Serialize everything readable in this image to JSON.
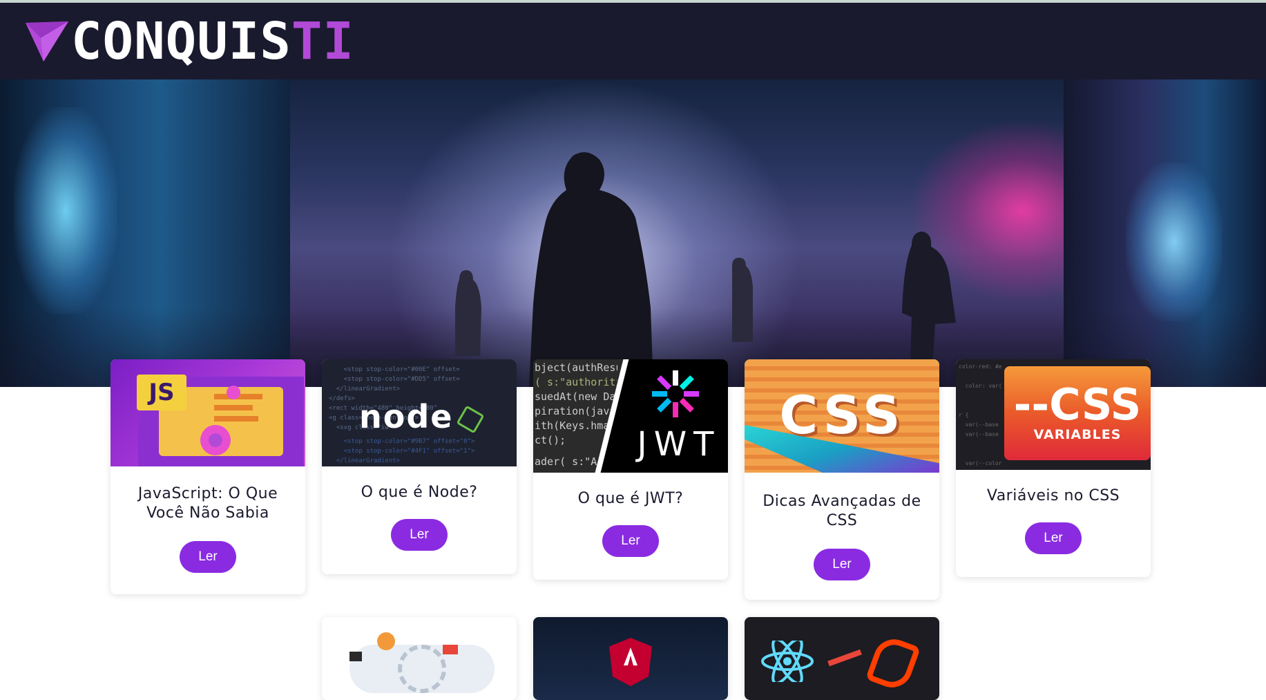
{
  "header": {
    "logo_text_main": "CONQUIS",
    "logo_text_accent": "TI",
    "accent_color": "#b24ad8",
    "background": "#1a1a2e"
  },
  "cards": [
    {
      "title": "JavaScript: O Que Você Não Sabia",
      "button": "Ler",
      "thumb_badge": "JS"
    },
    {
      "title": "O que é Node?",
      "button": "Ler",
      "thumb_badge": "node"
    },
    {
      "title": "O que é JWT?",
      "button": "Ler",
      "thumb_badge": "JWT"
    },
    {
      "title": "Dicas Avançadas de CSS",
      "button": "Ler",
      "thumb_badge": "CSS"
    },
    {
      "title": "Variáveis no CSS",
      "button": "Ler",
      "thumb_badge": "--CSS",
      "thumb_sub": "VARIABLES"
    }
  ],
  "thumb_text": {
    "jwt_code": [
      "bject(authResu",
      "( s:\"authoriti",
      "suedAt(new Da",
      "piration(java",
      "ith(Keys.hma",
      "ct();",
      "ader( s:\"A"
    ]
  },
  "button_color": "#8a2be2"
}
